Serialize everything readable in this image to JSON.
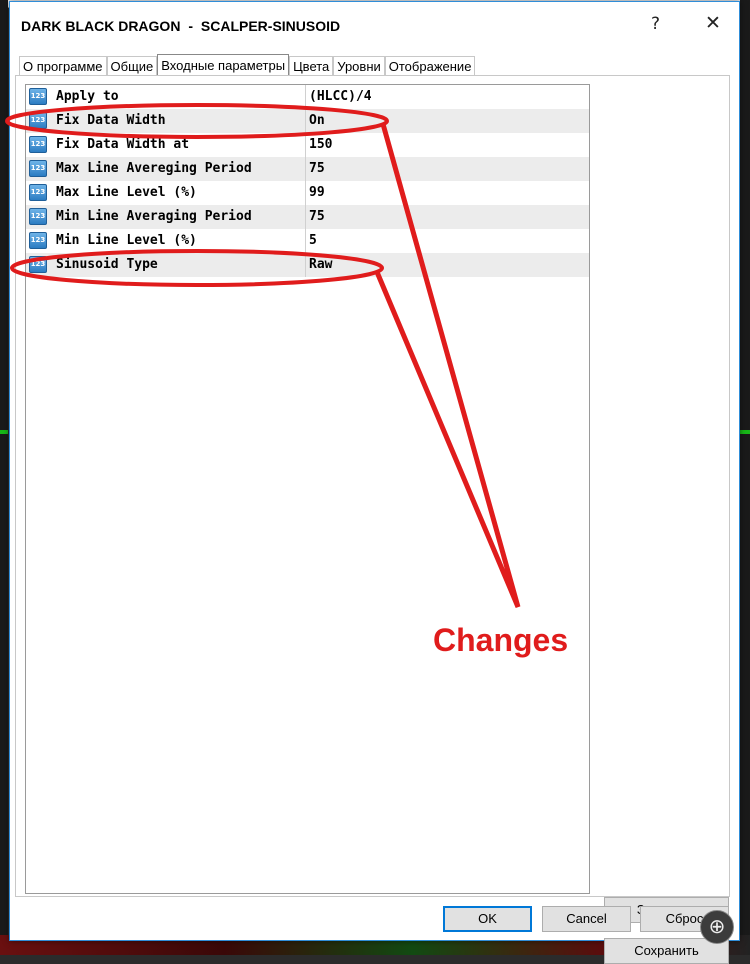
{
  "window": {
    "title_name": "DARK BLACK DRAGON",
    "title_separator": "-",
    "title_indicator": "SCALPER-SINUSOID",
    "help_symbol": "?",
    "close_symbol": "✕"
  },
  "tabs": [
    {
      "label": "О программе",
      "active": false
    },
    {
      "label": "Общие",
      "active": false
    },
    {
      "label": "Входные параметры",
      "active": true
    },
    {
      "label": "Цвета",
      "active": false
    },
    {
      "label": "Уровни",
      "active": false
    },
    {
      "label": "Отображение",
      "active": false
    }
  ],
  "param_icon_text": "123",
  "params": [
    {
      "name": "Apply to",
      "value": "(HLCC)/4"
    },
    {
      "name": "Fix Data Width",
      "value": "On"
    },
    {
      "name": "Fix Data Width at",
      "value": "150"
    },
    {
      "name": "Max Line Avereging Period",
      "value": "75"
    },
    {
      "name": "Max Line Level (%)",
      "value": "99"
    },
    {
      "name": "Min Line Averaging Period",
      "value": "75"
    },
    {
      "name": "Min Line Level (%)",
      "value": "5"
    },
    {
      "name": "Sinusoid Type",
      "value": "Raw"
    }
  ],
  "buttons": {
    "load": "Загрузить",
    "save": "Сохранить",
    "ok": "OK",
    "cancel": "Cancel",
    "reset": "Сброс"
  },
  "annotation": {
    "label": "Changes",
    "color": "#e01c1c"
  },
  "zoom_icon_symbol": "⊕"
}
